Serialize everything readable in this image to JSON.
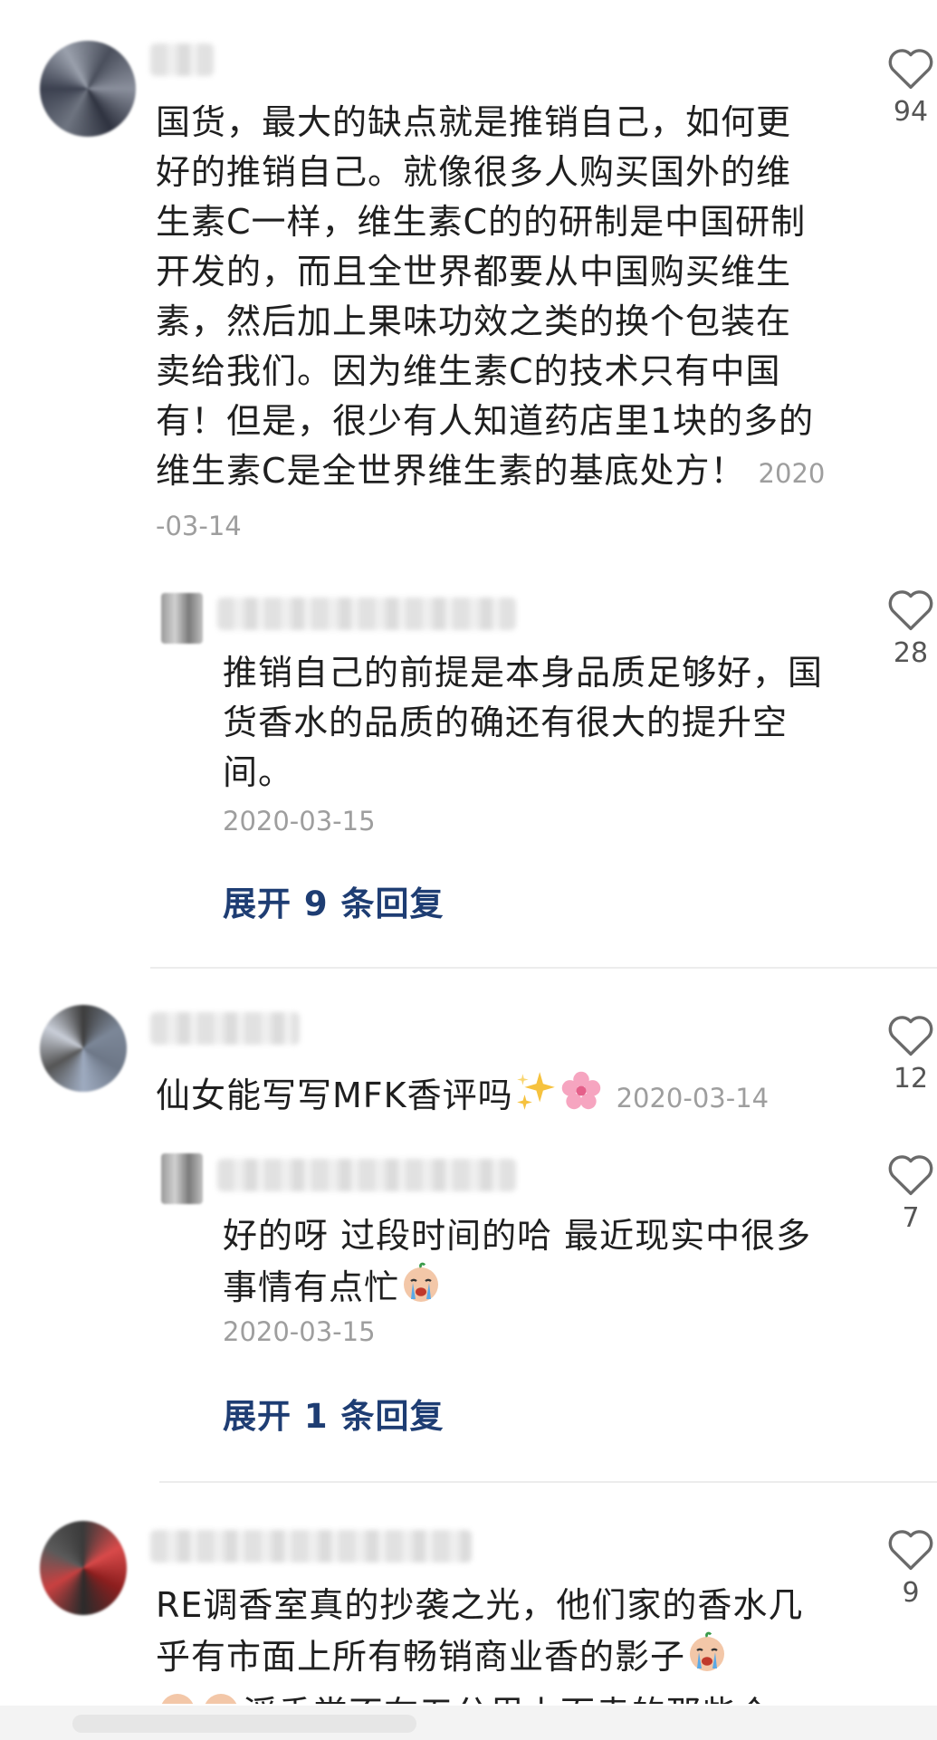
{
  "comments": [
    {
      "text": "国货，最大的缺点就是推销自己，如何更好的推销自己。就像很多人购买国外的维生素C一样，维生素C的的研制是中国研制开发的，而且全世界都要从中国购买维生素，然后加上果味功效之类的换个包装在卖给我们。因为维生素C的技术只有中国有！但是，很少有人知道药店里1块的多的维生素C是全世界维生素的基底处方！",
      "date": "2020-03-14",
      "likes": "94",
      "reply": {
        "text": "推销自己的前提是本身品质足够好，国货香水的品质的确还有很大的提升空间。",
        "date": "2020-03-15",
        "likes": "28"
      },
      "expand": "展开 9 条回复"
    },
    {
      "text": "仙女能写写MFK香评吗",
      "date": "2020-03-14",
      "likes": "12",
      "emojis": [
        "sparkles-emoji",
        "cherry-blossom-emoji"
      ],
      "reply": {
        "text": "好的呀 过段时间的哈 最近现实中很多事情有点忙",
        "date": "2020-03-15",
        "likes": "7"
      },
      "expand": "展开 1 条回复"
    },
    {
      "text": "RE调香室真的抄袭之光，他们家的香水几乎有市面上所有畅销商业香的影子",
      "text2": "浮香堂不在五分里上面卖的那些个",
      "likes": "9"
    }
  ],
  "icons": {
    "like": "heart-outline-icon",
    "cry": "crying-face-emoji"
  },
  "colors": {
    "link": "#1e3d73",
    "meta": "#9e9e9e"
  }
}
